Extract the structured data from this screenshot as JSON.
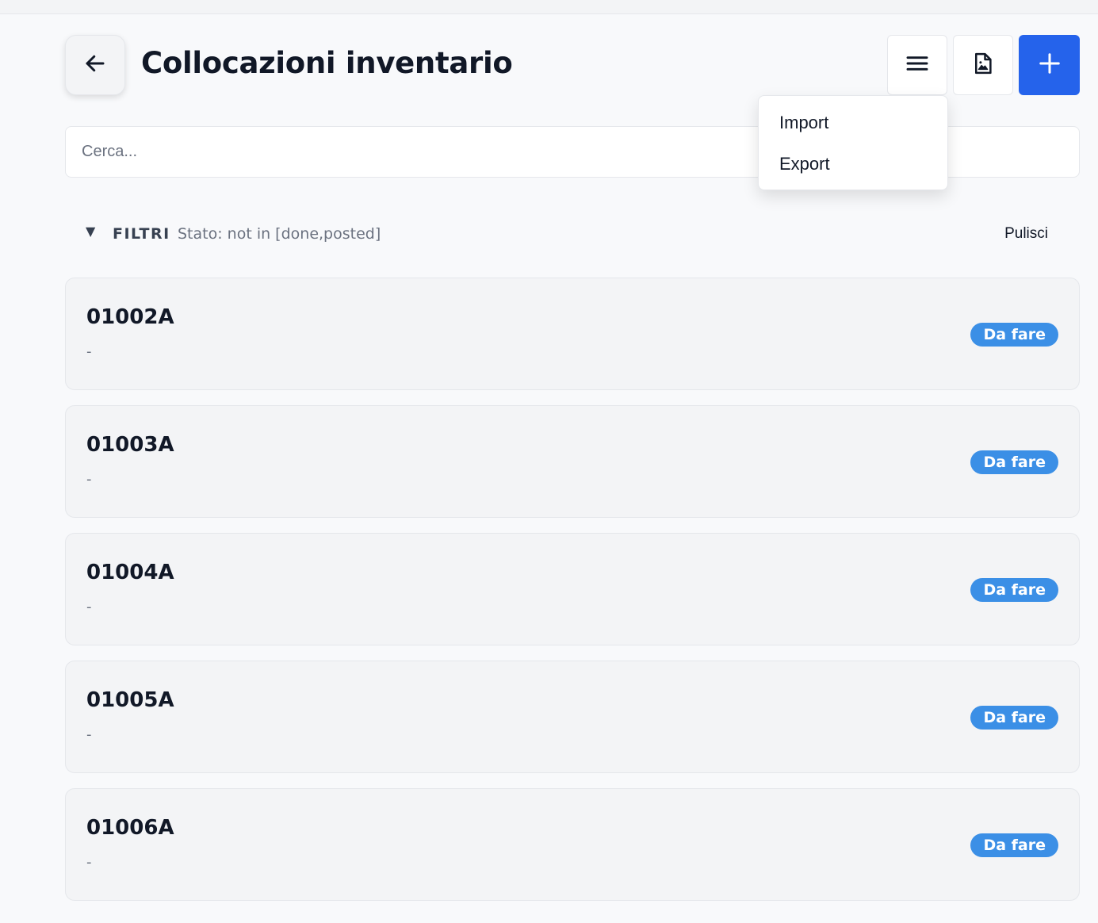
{
  "header": {
    "title": "Collocazioni inventario"
  },
  "search": {
    "placeholder": "Cerca...",
    "value": ""
  },
  "dropdown": {
    "items": [
      {
        "label": "Import"
      },
      {
        "label": "Export"
      }
    ]
  },
  "filters": {
    "toggle": "▼",
    "label": "FILTRI",
    "text": "Stato: not in [done,posted]",
    "clear_label": "Pulisci"
  },
  "items": [
    {
      "code": "01002A",
      "subtitle": "-",
      "status": "Da fare"
    },
    {
      "code": "01003A",
      "subtitle": "-",
      "status": "Da fare"
    },
    {
      "code": "01004A",
      "subtitle": "-",
      "status": "Da fare"
    },
    {
      "code": "01005A",
      "subtitle": "-",
      "status": "Da fare"
    },
    {
      "code": "01006A",
      "subtitle": "-",
      "status": "Da fare"
    }
  ],
  "colors": {
    "primary": "#2563eb",
    "badge": "#3b8fe6"
  },
  "icons": {
    "back": "arrow-left-icon",
    "menu": "hamburger-menu-icon",
    "file": "file-image-icon",
    "add": "plus-icon"
  }
}
